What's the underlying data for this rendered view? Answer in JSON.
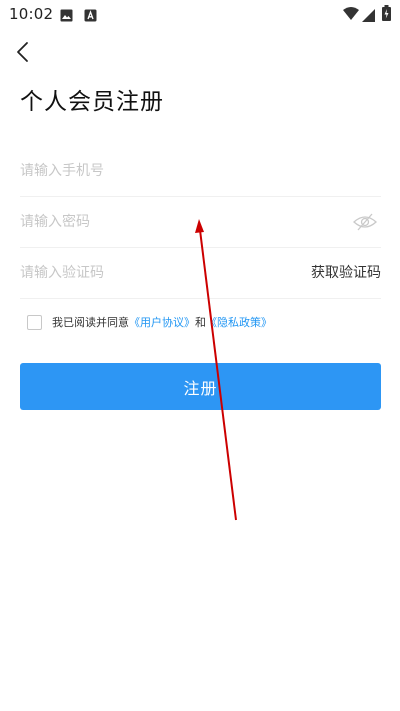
{
  "status_bar": {
    "time": "10:02",
    "left_icons": [
      "image-icon",
      "text-a-icon"
    ],
    "right_icons": [
      "wifi-icon",
      "signal-icon",
      "battery-icon"
    ]
  },
  "header": {
    "back_icon": "chevron-left-icon",
    "title": "个人会员注册"
  },
  "form": {
    "phone": {
      "placeholder": "请输入手机号",
      "value": ""
    },
    "password": {
      "placeholder": "请输入密码",
      "value": "",
      "toggle_icon": "eye-hidden-icon"
    },
    "code": {
      "placeholder": "请输入验证码",
      "value": "",
      "get_code_label": "获取验证码"
    }
  },
  "agreement": {
    "checked": false,
    "prefix": "我已阅读并同意",
    "user_agreement": "《用户协议》",
    "and": "和",
    "privacy_policy": "《隐私政策》"
  },
  "register": {
    "label": "注册"
  },
  "colors": {
    "primary": "#2d96f4",
    "link": "#2196f3",
    "annotation_arrow": "#cc0000"
  }
}
